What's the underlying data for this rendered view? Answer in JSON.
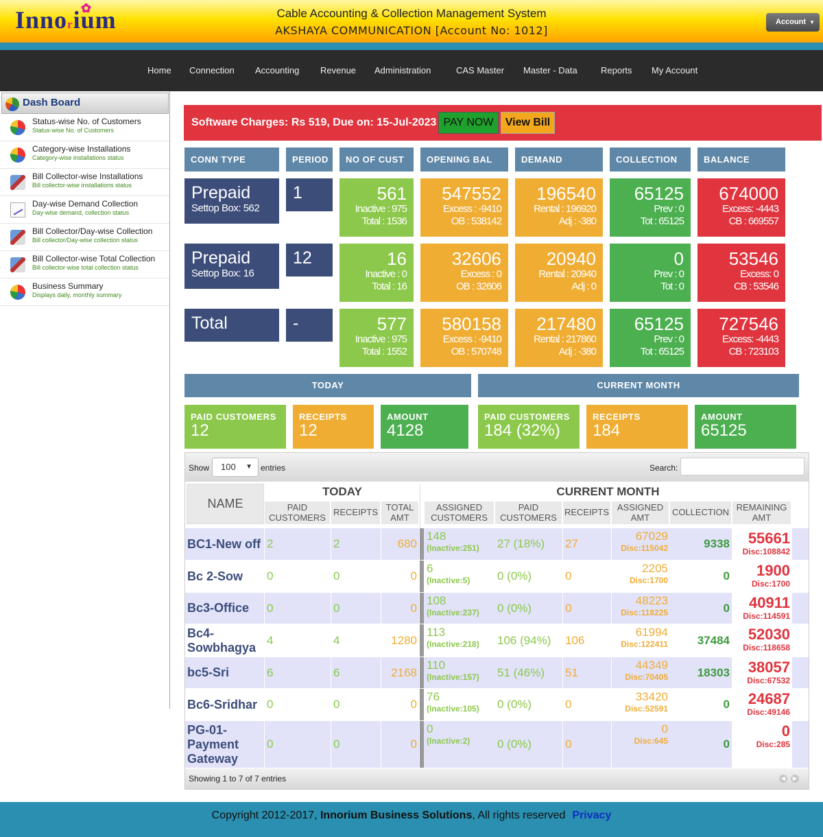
{
  "header": {
    "logo_pre": "Inno",
    "logo_mid": "r",
    "logo_post": "ium",
    "app_title": "Cable Accounting & Collection Management System",
    "account_line": "AKSHAYA COMMUNICATION [Account No: 1012]",
    "account_button": "Account"
  },
  "nav": [
    "Home",
    "Connection",
    "Accounting",
    "Revenue",
    "Administration",
    "CAS Master",
    "Master - Data",
    "Reports",
    "My Account"
  ],
  "sidebar": {
    "title": "Dash Board",
    "items": [
      {
        "label": "Status-wise No. of Customers",
        "sub": "Status-wise No. of Customers",
        "icon": "pie-chart-icon"
      },
      {
        "label": "Category-wise Installations",
        "sub": "Category-wise installations status",
        "icon": "pie-chart-icon"
      },
      {
        "label": "Bill Collector-wise Installations",
        "sub": "Bill collector-wise installations status",
        "icon": "user-report-icon"
      },
      {
        "label": "Day-wise Demand Collection",
        "sub": "Day-wise demand, collection status",
        "icon": "line-chart-icon"
      },
      {
        "label": "Bill Collector/Day-wise Collection",
        "sub": "Bill collector/Day-wise collection status",
        "icon": "user-report-icon"
      },
      {
        "label": "Bill Collector-wise Total Collection",
        "sub": "Bill collector-wise total collection status",
        "icon": "user-report-icon"
      },
      {
        "label": "Business Summary",
        "sub": "Displays daily, monthly summary",
        "icon": "pie-chart-icon"
      }
    ]
  },
  "alert": {
    "text": "Software Charges: Rs 519, Due on: 15-Jul-2023",
    "pay_now": "PAY NOW",
    "view_bill": "View Bill"
  },
  "summary_headers": [
    "CONN TYPE",
    "PERIOD",
    "NO OF CUST",
    "OPENING BAL",
    "DEMAND",
    "COLLECTION",
    "BALANCE"
  ],
  "summary_rows": [
    {
      "type": "Prepaid",
      "type_sub": "Settop Box: 562",
      "period": "1",
      "cust": "561",
      "cust_s1": "Inactive : 975",
      "cust_s2": "Total : 1536",
      "ob": "547552",
      "ob_s1": "Excess : -9410",
      "ob_s2": "OB : 538142",
      "dem": "196540",
      "dem_s1": "Rental : 196920",
      "dem_s2": "Adj : -380",
      "col": "65125",
      "col_s1": "Prev : 0",
      "col_s2": "Tot : 65125",
      "bal": "674000",
      "bal_s1": "Excess: -4443",
      "bal_s2": "CB : 669557"
    },
    {
      "type": "Prepaid",
      "type_sub": "Settop Box: 16",
      "period": "12",
      "cust": "16",
      "cust_s1": "Inactive : 0",
      "cust_s2": "Total : 16",
      "ob": "32606",
      "ob_s1": "Excess : 0",
      "ob_s2": "OB : 32606",
      "dem": "20940",
      "dem_s1": "Rental : 20940",
      "dem_s2": "Adj : 0",
      "col": "0",
      "col_s1": "Prev : 0",
      "col_s2": "Tot : 0",
      "bal": "53546",
      "bal_s1": "Excess: 0",
      "bal_s2": "CB : 53546"
    },
    {
      "type": "Total",
      "type_sub": "",
      "period": "-",
      "cust": "577",
      "cust_s1": "Inactive : 975",
      "cust_s2": "Total : 1552",
      "ob": "580158",
      "ob_s1": "Excess : -9410",
      "ob_s2": "OB : 570748",
      "dem": "217480",
      "dem_s1": "Rental : 217860",
      "dem_s2": "Adj : -380",
      "col": "65125",
      "col_s1": "Prev : 0",
      "col_s2": "Tot : 65125",
      "bal": "727546",
      "bal_s1": "Excess: -4443",
      "bal_s2": "CB : 723103"
    }
  ],
  "today": {
    "title": "TODAY",
    "paid_label": "PAID CUSTOMERS",
    "paid": "12",
    "receipts_label": "RECEIPTS",
    "receipts": "12",
    "amount_label": "AMOUNT",
    "amount": "4128"
  },
  "month": {
    "title": "CURRENT MONTH",
    "paid_label": "PAID CUSTOMERS",
    "paid": "184 (32%)",
    "receipts_label": "RECEIPTS",
    "receipts": "184",
    "amount_label": "AMOUNT",
    "amount": "65125"
  },
  "table": {
    "show": "Show",
    "entries_value": "100",
    "entries": "entries",
    "search": "Search:",
    "footer": "Showing 1 to 7 of 7 entries",
    "h_name": "NAME",
    "h_today": "TODAY",
    "h_month": "CURRENT MONTH",
    "sub_headers": [
      "PAID CUSTOMERS",
      "RECEIPTS",
      "TOTAL AMT",
      "ASSIGNED CUSTOMERS",
      "PAID CUSTOMERS",
      "RECEIPTS",
      "ASSIGNED AMT",
      "COLLECTION",
      "REMAINING AMT"
    ],
    "rows": [
      {
        "name": "BC1-New off",
        "tp": "2",
        "tr": "2",
        "ta": "680",
        "ac": "148",
        "ai": "(Inactive:251)",
        "mp": "27 (18%)",
        "mr": "27",
        "aa": "67029",
        "ad": "Disc:115042",
        "co": "9338",
        "ra": "55661",
        "rd": "Disc:108842"
      },
      {
        "name": "Bc 2-Sow",
        "tp": "0",
        "tr": "0",
        "ta": "0",
        "ac": "6",
        "ai": "(Inactive:5)",
        "mp": "0 (0%)",
        "mr": "0",
        "aa": "2205",
        "ad": "Disc:1700",
        "co": "0",
        "ra": "1900",
        "rd": "Disc:1700"
      },
      {
        "name": "Bc3-Office",
        "tp": "0",
        "tr": "0",
        "ta": "0",
        "ac": "108",
        "ai": "(Inactive:237)",
        "mp": "0 (0%)",
        "mr": "0",
        "aa": "48223",
        "ad": "Disc:118225",
        "co": "0",
        "ra": "40911",
        "rd": "Disc:114591"
      },
      {
        "name": "Bc4-Sowbhagya",
        "tp": "4",
        "tr": "4",
        "ta": "1280",
        "ac": "113",
        "ai": "(Inactive:218)",
        "mp": "106 (94%)",
        "mr": "106",
        "aa": "61994",
        "ad": "Disc:122411",
        "co": "37484",
        "ra": "52030",
        "rd": "Disc:118658"
      },
      {
        "name": "bc5-Sri",
        "tp": "6",
        "tr": "6",
        "ta": "2168",
        "ac": "110",
        "ai": "(Inactive:157)",
        "mp": "51 (46%)",
        "mr": "51",
        "aa": "44349",
        "ad": "Disc:70405",
        "co": "18303",
        "ra": "38057",
        "rd": "Disc:67532"
      },
      {
        "name": "Bc6-Sridhar",
        "tp": "0",
        "tr": "0",
        "ta": "0",
        "ac": "76",
        "ai": "(Inactive:105)",
        "mp": "0 (0%)",
        "mr": "0",
        "aa": "33420",
        "ad": "Disc:52591",
        "co": "0",
        "ra": "24687",
        "rd": "Disc:49146"
      },
      {
        "name": "PG-01-Payment Gateway",
        "tp": "0",
        "tr": "0",
        "ta": "0",
        "ac": "0",
        "ai": "(Inactive:2)",
        "mp": "0 (0%)",
        "mr": "0",
        "aa": "0",
        "ad": "Disc:645",
        "co": "0",
        "ra": "0",
        "rd": "Disc:285"
      }
    ]
  },
  "footer": {
    "pre": "Copyright 2012-2017,",
    "company": "Innorium Business Solutions",
    "post": ", All rights reserved",
    "privacy": "Privacy"
  }
}
